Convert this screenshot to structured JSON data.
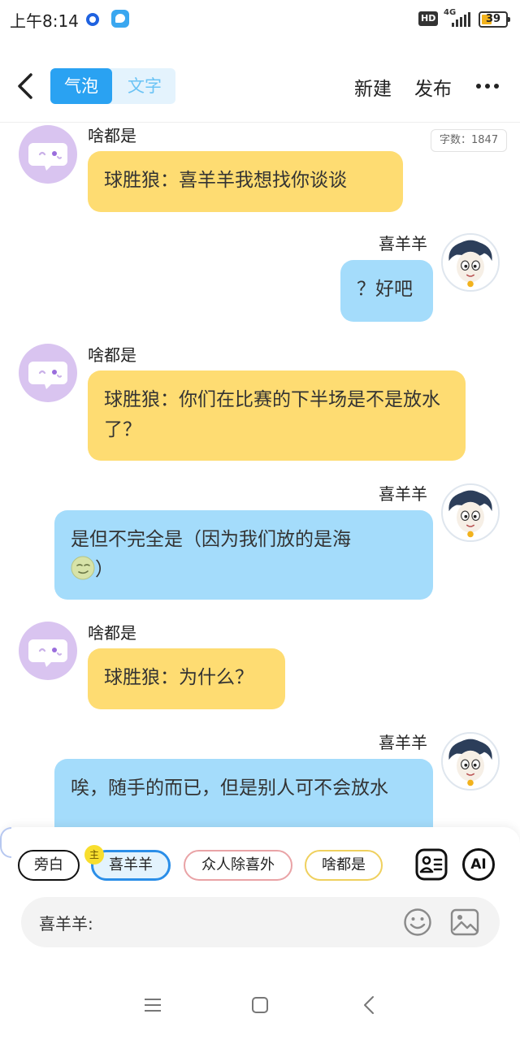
{
  "status_bar": {
    "time": "上午8:14",
    "hd": "HD",
    "network": "4G",
    "battery": "39",
    "battery_level": 0.39
  },
  "header": {
    "tabs": [
      {
        "label": "气泡",
        "active": true
      },
      {
        "label": "文字",
        "active": false
      }
    ],
    "new_label": "新建",
    "publish_label": "发布",
    "back_icon": "chevron-left-icon",
    "more_icon": "more-dots-icon"
  },
  "chat": {
    "word_count": "字数：1847",
    "messages": [
      {
        "side": "left",
        "name": "啥都是",
        "text": "球胜狼：喜羊羊我想找你谈谈"
      },
      {
        "side": "right",
        "name": "喜羊羊",
        "text": "？好吧"
      },
      {
        "side": "left",
        "name": "啥都是",
        "text": "球胜狼：你们在比赛的下半场是不是放水了？"
      },
      {
        "side": "right",
        "name": "喜羊羊",
        "text": "是但不完全是（因为我们放的是海",
        "text_after_emoji": "）",
        "emoji": "smirk-face-emoji"
      },
      {
        "side": "left",
        "name": "啥都是",
        "text": "球胜狼：为什么？"
      },
      {
        "side": "right",
        "name": "喜羊羊",
        "text": "唉，随手的而已，但是别人可不会放水"
      }
    ]
  },
  "bottom": {
    "roles": [
      {
        "label": "旁白"
      },
      {
        "label": "喜羊羊",
        "badge": "主",
        "selected": true
      },
      {
        "label": "众人除喜外"
      },
      {
        "label": "啥都是"
      }
    ],
    "ai_label": "AI",
    "input_prefix": "喜羊羊:",
    "input_value": "",
    "colors": {
      "accent": "#2aa2f2",
      "yellow_bubble": "#fedc72",
      "blue_bubble": "#a4dcfb"
    }
  }
}
